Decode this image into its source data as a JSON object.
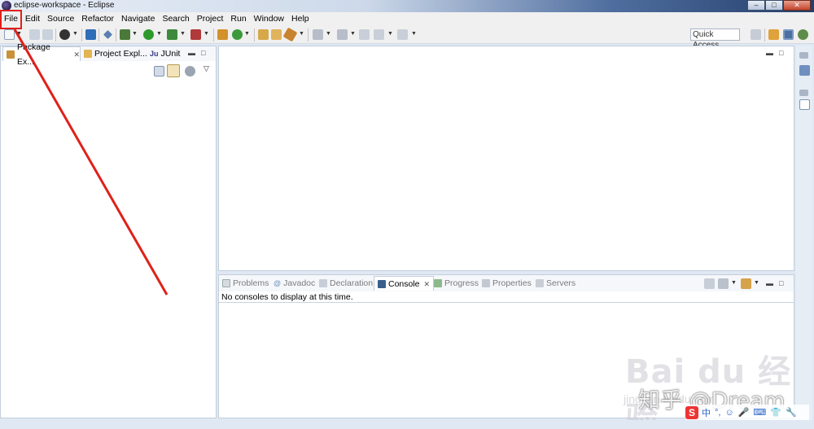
{
  "window": {
    "title": "eclipse-workspace - Eclipse",
    "minimize": "–",
    "maximize": "□",
    "close": "✕"
  },
  "menu": [
    "File",
    "Edit",
    "Source",
    "Refactor",
    "Navigate",
    "Search",
    "Project",
    "Run",
    "Window",
    "Help"
  ],
  "toolbar": {
    "quick_access": "Quick Access"
  },
  "left_panel": {
    "tabs": [
      {
        "label": "Package Ex...",
        "icon": "package-explorer-icon",
        "active": true,
        "close": "✕"
      },
      {
        "label": "Project Expl...",
        "icon": "project-explorer-icon",
        "active": false
      },
      {
        "label": "JUnit",
        "icon": "junit-icon",
        "icon_text": "Ju",
        "active": false
      }
    ]
  },
  "bottom_panel": {
    "tabs": [
      {
        "label": "Problems",
        "icon": "problems-icon"
      },
      {
        "label": "Javadoc",
        "icon": "javadoc-icon",
        "icon_text": "@"
      },
      {
        "label": "Declaration",
        "icon": "declaration-icon"
      },
      {
        "label": "Console",
        "icon": "console-icon",
        "active": true,
        "close": "✕"
      },
      {
        "label": "Progress",
        "icon": "progress-icon"
      },
      {
        "label": "Properties",
        "icon": "properties-icon"
      },
      {
        "label": "Servers",
        "icon": "servers-icon"
      }
    ],
    "console_message": "No consoles to display at this time."
  },
  "watermark": {
    "logo": "Bai du 经验",
    "text": "知乎 @Dream",
    "sub": "jingyan.baidu.com"
  },
  "ime": {
    "logo": "S",
    "glyphs": [
      "中",
      "°,",
      "☺",
      "🎤",
      "⌨",
      "👕",
      "🔧"
    ]
  },
  "colors": {
    "annotation": "#e0201a",
    "title_gradient_end": "#253f6b",
    "active_tab_text": "#000000"
  }
}
